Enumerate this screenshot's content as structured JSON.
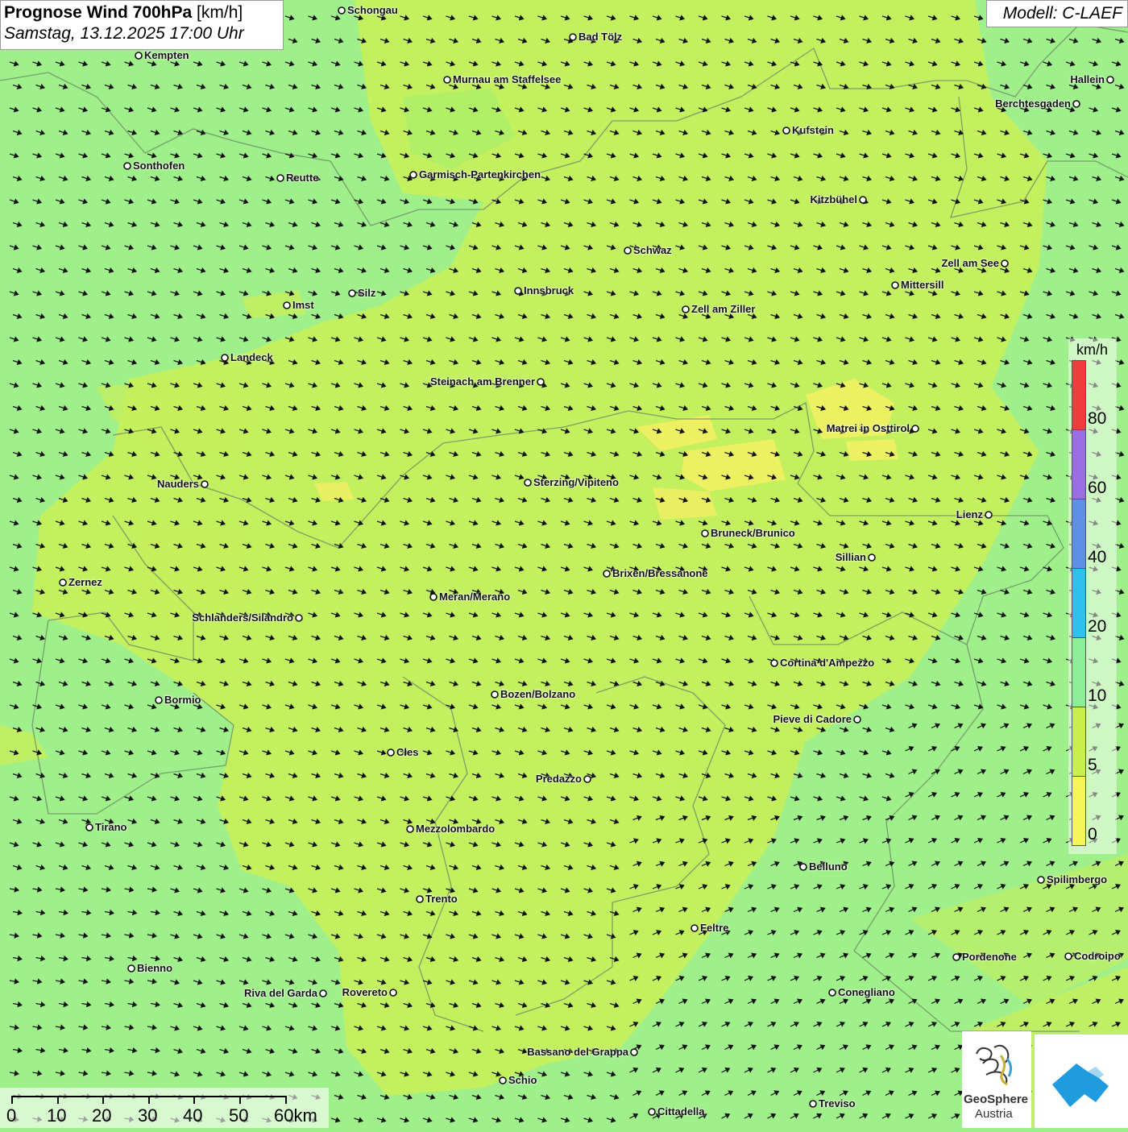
{
  "header": {
    "title_bold": "Prognose Wind 700hPa",
    "title_unit": "[km/h]",
    "subtitle": "Samstag, 13.12.2025 17:00 Uhr",
    "model": "Modell: C-LAEF"
  },
  "cities": [
    {
      "name": "Schongau"
    },
    {
      "name": "Bad Tölz"
    },
    {
      "name": "Kempten"
    },
    {
      "name": "Murnau am Staffelsee"
    },
    {
      "name": "Hallein"
    },
    {
      "name": "Berchtesgaden"
    },
    {
      "name": "Kufstein"
    },
    {
      "name": "Sonthofen"
    },
    {
      "name": "Reutte"
    },
    {
      "name": "Garmisch-Partenkirchen"
    },
    {
      "name": "Kitzbühel"
    },
    {
      "name": "Schwaz"
    },
    {
      "name": "Zell am See"
    },
    {
      "name": "Mittersill"
    },
    {
      "name": "Innsbruck"
    },
    {
      "name": "Silz"
    },
    {
      "name": "Imst"
    },
    {
      "name": "Zell am Ziller"
    },
    {
      "name": "Landeck"
    },
    {
      "name": "Steinach am Brenner"
    },
    {
      "name": "Matrei in Osttirol"
    },
    {
      "name": "Nauders"
    },
    {
      "name": "Sterzing/Vipiteno"
    },
    {
      "name": "Lienz"
    },
    {
      "name": "Bruneck/Brunico"
    },
    {
      "name": "Sillian"
    },
    {
      "name": "Zernez"
    },
    {
      "name": "Brixen/Bressanone"
    },
    {
      "name": "Meran/Merano"
    },
    {
      "name": "Schlanders/Silandro"
    },
    {
      "name": "Cortina d'Ampezzo"
    },
    {
      "name": "Bozen/Bolzano"
    },
    {
      "name": "Bormio"
    },
    {
      "name": "Pieve di Cadore"
    },
    {
      "name": "Cles"
    },
    {
      "name": "Predazzo"
    },
    {
      "name": "Tirano"
    },
    {
      "name": "Mezzolombardo"
    },
    {
      "name": "Belluno"
    },
    {
      "name": "Spilimbergo"
    },
    {
      "name": "Trento"
    },
    {
      "name": "Feltre"
    },
    {
      "name": "Bienno"
    },
    {
      "name": "Pordenone"
    },
    {
      "name": "Codroipo"
    },
    {
      "name": "Riva del Garda"
    },
    {
      "name": "Rovereto"
    },
    {
      "name": "Conegliano"
    },
    {
      "name": "Bassano del Grappa"
    },
    {
      "name": "Schio"
    },
    {
      "name": "Treviso"
    },
    {
      "name": "Cittadella"
    }
  ],
  "legend": {
    "unit": "km/h",
    "labels": [
      "80",
      "60",
      "40",
      "20",
      "10",
      "5",
      "0"
    ],
    "colors": [
      "#f03c3c",
      "#9a6ce6",
      "#5f8fe6",
      "#2fbff0",
      "#8cee96",
      "#c9ef4c",
      "#f5f55a"
    ]
  },
  "scale": {
    "labels": [
      "0",
      "10",
      "20",
      "30",
      "40",
      "50",
      "60km"
    ]
  },
  "logos": {
    "geosphere_line1": "GeoSphere",
    "geosphere_line2": "Austria"
  },
  "wind": {
    "dominant_direction": "west-northwest",
    "colors": {
      "weak": "#e3f06a",
      "moderate": "#bdef5a",
      "stronger": "#9bef88"
    }
  }
}
